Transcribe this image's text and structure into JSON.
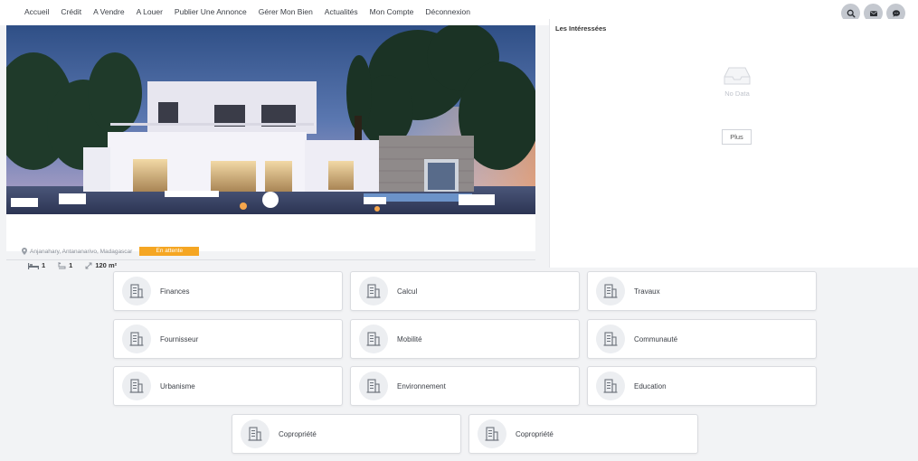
{
  "nav": {
    "links": [
      "Accueil",
      "Crédit",
      "A Vendre",
      "A Louer",
      "Publier Une Annonce",
      "Gérer Mon Bien",
      "Actualités",
      "Mon Compte",
      "Déconnexion"
    ]
  },
  "property": {
    "location": "Anjanahary, Antananarivo, Madagascar",
    "status": "En attente",
    "beds": "1",
    "baths": "1",
    "area": "120 m²"
  },
  "interested": {
    "title": "Les Intéressées",
    "empty_text": "No Data",
    "more_label": "Plus"
  },
  "services": [
    "Finances",
    "Calcul",
    "Travaux",
    "Fournisseur",
    "Mobilité",
    "Communauté",
    "Urbanisme",
    "Environnement",
    "Education",
    "Copropriété",
    "Copropriété"
  ],
  "colors": {
    "accent": "#f5a623",
    "nav_icon_bg": "#c4c8cf",
    "page_bg": "#f2f3f5"
  }
}
